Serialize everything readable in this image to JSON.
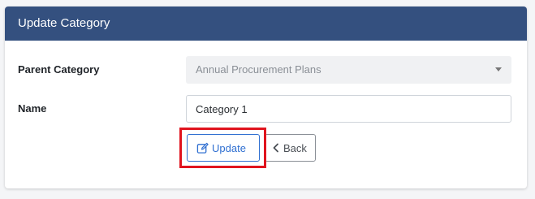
{
  "panel": {
    "title": "Update Category"
  },
  "form": {
    "parent_category": {
      "label": "Parent Category",
      "selected_value": "Annual Procurement Plans"
    },
    "name": {
      "label": "Name",
      "value": "Category 1"
    }
  },
  "actions": {
    "update_label": "Update",
    "back_label": "Back"
  },
  "icons": {
    "update": "edit-icon",
    "back": "chevron-left-icon"
  },
  "colors": {
    "header_bg": "#34507f",
    "primary": "#2f6fd1",
    "highlight": "#e0141e"
  }
}
